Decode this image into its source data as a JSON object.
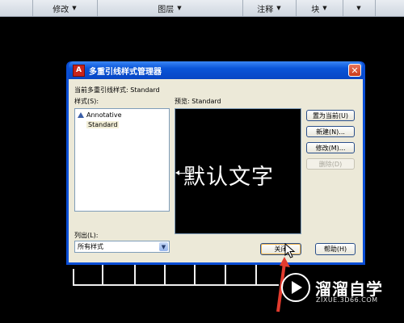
{
  "ribbon": {
    "panels": [
      {
        "label": "修改"
      },
      {
        "label": "图层"
      },
      {
        "label": "注释"
      },
      {
        "label": "块"
      }
    ]
  },
  "dialog": {
    "title": "多重引线样式管理器",
    "close_symbol": "✕",
    "current_style_label": "当前多重引线样式: Standard",
    "styles_label": "样式(S):",
    "preview_label": "预览: Standard",
    "styles": [
      {
        "name": "Annotative",
        "annotative": true
      },
      {
        "name": "Standard",
        "annotative": false
      }
    ],
    "preview_text": "默认文字",
    "list_label": "列出(L):",
    "list_value": "所有样式",
    "buttons": {
      "set_current": "置为当前(U)",
      "new": "新建(N)...",
      "modify": "修改(M)...",
      "delete": "删除(D)",
      "close": "关闭",
      "help": "帮助(H)"
    }
  },
  "watermark": {
    "main": "溜溜自学",
    "sub": "ZIXUE.3D66.COM"
  },
  "colors": {
    "title_bar": "#0a4ed6",
    "dialog_face": "#ece9d8",
    "canvas": "#000000",
    "annotation_arrow": "#e23b2e"
  }
}
